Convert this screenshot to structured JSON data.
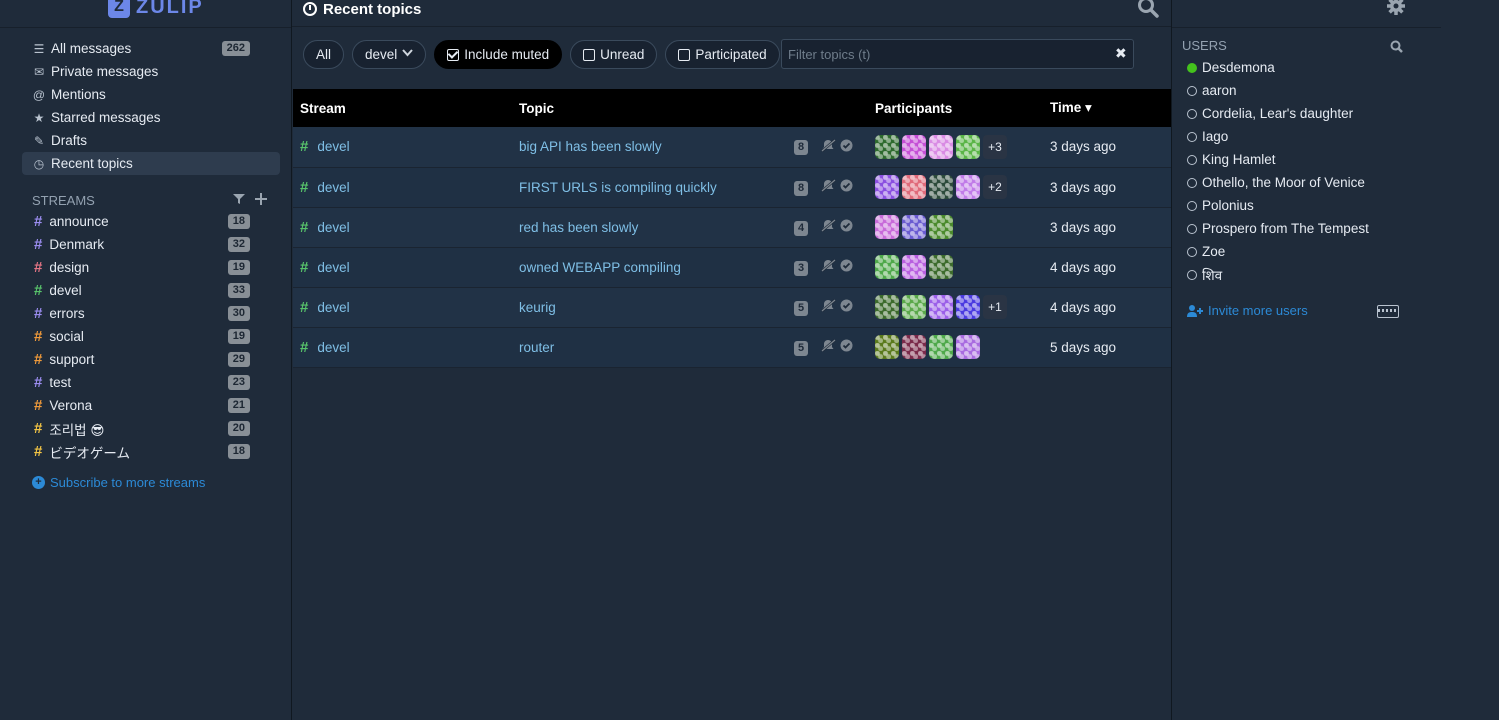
{
  "app": {
    "logo_text": "ZULIP",
    "logo_mark": "Z"
  },
  "sidebar": {
    "nav": [
      {
        "label": "All messages",
        "icon": "list-icon",
        "glyph": "☰",
        "count": "262",
        "active": false
      },
      {
        "label": "Private messages",
        "icon": "envelope-icon",
        "glyph": "✉",
        "count": "",
        "active": false
      },
      {
        "label": "Mentions",
        "icon": "at-icon",
        "glyph": "@",
        "count": "",
        "active": false
      },
      {
        "label": "Starred messages",
        "icon": "star-icon",
        "glyph": "★",
        "count": "",
        "active": false
      },
      {
        "label": "Drafts",
        "icon": "pencil-icon",
        "glyph": "✎",
        "count": "",
        "active": false
      },
      {
        "label": "Recent topics",
        "icon": "clock-icon",
        "glyph": "◷",
        "count": "",
        "active": true
      }
    ],
    "streams_header": "STREAMS",
    "streams": [
      {
        "name": "announce",
        "color": "#9b8df0",
        "count": "18"
      },
      {
        "name": "Denmark",
        "color": "#9b8df0",
        "count": "32"
      },
      {
        "name": "design",
        "color": "#e47585",
        "count": "19"
      },
      {
        "name": "devel",
        "color": "#58c36b",
        "count": "33"
      },
      {
        "name": "errors",
        "color": "#9b8df0",
        "count": "30"
      },
      {
        "name": "social",
        "color": "#ef9a3b",
        "count": "19"
      },
      {
        "name": "support",
        "color": "#ef9a3b",
        "count": "29"
      },
      {
        "name": "test",
        "color": "#9b8df0",
        "count": "23"
      },
      {
        "name": "Verona",
        "color": "#ef9a3b",
        "count": "21"
      },
      {
        "name": "조리법 😎",
        "color": "#f3c545",
        "count": "20"
      },
      {
        "name": "ビデオゲーム",
        "color": "#f3c545",
        "count": "18"
      }
    ],
    "subscribe_label": "Subscribe to more streams"
  },
  "main": {
    "title": "Recent topics",
    "filters": {
      "all": "All",
      "stream_select": "devel",
      "include_muted": "Include muted",
      "unread": "Unread",
      "participated": "Participated",
      "search_placeholder": "Filter topics (t)",
      "clear": "✖"
    },
    "columns": {
      "stream": "Stream",
      "topic": "Topic",
      "participants": "Participants",
      "time": "Time ▾"
    },
    "rows": [
      {
        "stream": "devel",
        "topic": "big API has been slowly",
        "count": "8",
        "avatars": [
          "#2e6b2e",
          "#c54fd6",
          "#d98be4",
          "#5ab547"
        ],
        "extra": "+3",
        "time": "3 days ago"
      },
      {
        "stream": "devel",
        "topic": "FIRST URLS is compiling quickly",
        "count": "8",
        "avatars": [
          "#8a4fe0",
          "#e06a7a",
          "#2c4a3a",
          "#c07be8"
        ],
        "extra": "+2",
        "time": "3 days ago"
      },
      {
        "stream": "devel",
        "topic": "red has been slowly",
        "count": "4",
        "avatars": [
          "#c76ad9",
          "#6a5bd1",
          "#4a8a2c"
        ],
        "extra": "",
        "time": "3 days ago"
      },
      {
        "stream": "devel",
        "topic": "owned WEBAPP compiling",
        "count": "3",
        "avatars": [
          "#4ea84a",
          "#b85fe0",
          "#3c6b2c"
        ],
        "extra": "",
        "time": "4 days ago"
      },
      {
        "stream": "devel",
        "topic": "keurig",
        "count": "5",
        "avatars": [
          "#3c6b2c",
          "#5aa84a",
          "#9b5fe8",
          "#4a3ae0"
        ],
        "extra": "+1",
        "time": "4 days ago"
      },
      {
        "stream": "devel",
        "topic": "router",
        "count": "5",
        "avatars": [
          "#5a7a1c",
          "#7a2a4a",
          "#4ea84a",
          "#a86be0"
        ],
        "extra": "",
        "time": "5 days ago"
      }
    ]
  },
  "right": {
    "users_header": "USERS",
    "users": [
      {
        "name": "Desdemona",
        "active": true
      },
      {
        "name": "aaron",
        "active": false
      },
      {
        "name": "Cordelia, Lear's daughter",
        "active": false
      },
      {
        "name": "Iago",
        "active": false
      },
      {
        "name": "King Hamlet",
        "active": false
      },
      {
        "name": "Othello, the Moor of Venice",
        "active": false
      },
      {
        "name": "Polonius",
        "active": false
      },
      {
        "name": "Prospero from The Tempest",
        "active": false
      },
      {
        "name": "Zoe",
        "active": false
      },
      {
        "name": "शिव",
        "active": false
      }
    ],
    "invite_label": "Invite more users"
  }
}
